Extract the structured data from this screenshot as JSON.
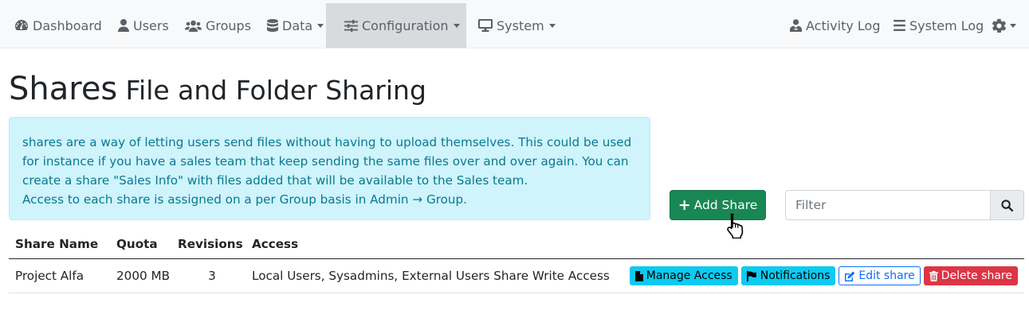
{
  "navbar": {
    "left": [
      {
        "label": "Dashboard",
        "icon": "dashboard-icon"
      },
      {
        "label": "Users",
        "icon": "user-icon"
      },
      {
        "label": "Groups",
        "icon": "users-icon"
      },
      {
        "label": "Data",
        "icon": "database-icon",
        "dropdown": true
      },
      {
        "label": "Configuration",
        "icon": "sliders-icon",
        "dropdown": true,
        "active": true
      },
      {
        "label": "System",
        "icon": "desktop-icon",
        "dropdown": true
      }
    ],
    "right": [
      {
        "label": "Activity Log",
        "icon": "user-log-icon"
      },
      {
        "label": "System Log",
        "icon": "list-icon"
      },
      {
        "label": "",
        "icon": "gear-icon",
        "dropdown": true
      }
    ]
  },
  "page": {
    "title": "Shares",
    "subtitle": "File and Folder Sharing"
  },
  "info": {
    "line1": "shares are a way of letting users send files without having to upload themselves. This could be used for instance if you have a sales team that keep sending the same files over and over again. You can create a share \"Sales Info\" with files added that will be available to the Sales team.",
    "line2": "Access to each share is assigned on a per Group basis in Admin → Group."
  },
  "toolbar": {
    "add_label": "Add Share",
    "filter_placeholder": "Filter"
  },
  "table": {
    "headers": {
      "name": "Share Name",
      "quota": "Quota",
      "revisions": "Revisions",
      "access": "Access"
    },
    "rows": [
      {
        "name": "Project Alfa",
        "quota": "2000 MB",
        "revisions": "3",
        "access": "Local Users, Sysadmins, External Users Share Write Access"
      }
    ],
    "actions": {
      "manage": "Manage Access",
      "notifications": "Notifications",
      "edit": "Edit share",
      "delete": "Delete share"
    }
  },
  "colors": {
    "success": "#198754",
    "info": "#0dcaf0",
    "primary": "#0d6efd",
    "danger": "#dc3545",
    "info_bg": "#cff4fc"
  }
}
